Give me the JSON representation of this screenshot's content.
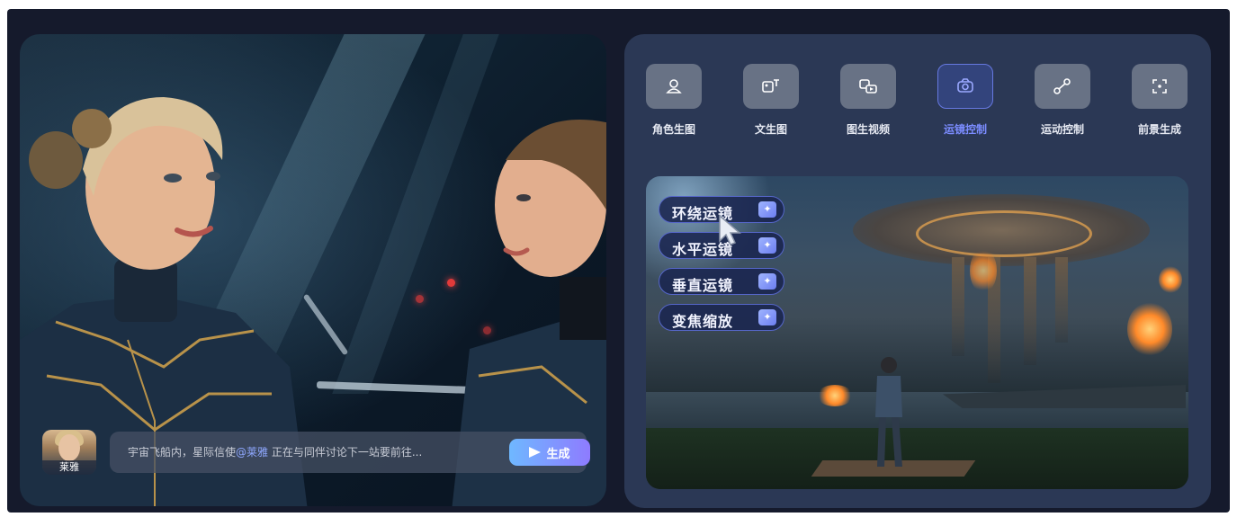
{
  "left_panel": {
    "avatar": {
      "name": "莱雅"
    },
    "prompt": {
      "prefix": "宇宙飞船内，星际信使",
      "mention": "@莱雅",
      "suffix": " 正在与同伴讨论下一站要前往..."
    },
    "generate_button": {
      "label": "生成"
    }
  },
  "right_panel": {
    "tools": [
      {
        "label": "角色生图",
        "icon": "person-icon",
        "active": false
      },
      {
        "label": "文生图",
        "icon": "text-image-icon",
        "active": false
      },
      {
        "label": "图生视频",
        "icon": "image-video-icon",
        "active": false
      },
      {
        "label": "运镜控制",
        "icon": "camera-icon",
        "active": true
      },
      {
        "label": "运动控制",
        "icon": "motion-nodes-icon",
        "active": false
      },
      {
        "label": "前景生成",
        "icon": "focus-frame-icon",
        "active": false
      }
    ],
    "camera_moves": [
      {
        "label": "环绕运镜"
      },
      {
        "label": "水平运镜"
      },
      {
        "label": "垂直运镜"
      },
      {
        "label": "变焦缩放"
      }
    ]
  },
  "colors": {
    "frame_bg": "#151a2c",
    "right_card_bg": "#2b3855",
    "active_accent": "#7b8cff",
    "button_gradient_start": "#6fb8ff",
    "button_gradient_end": "#8e7bff"
  }
}
